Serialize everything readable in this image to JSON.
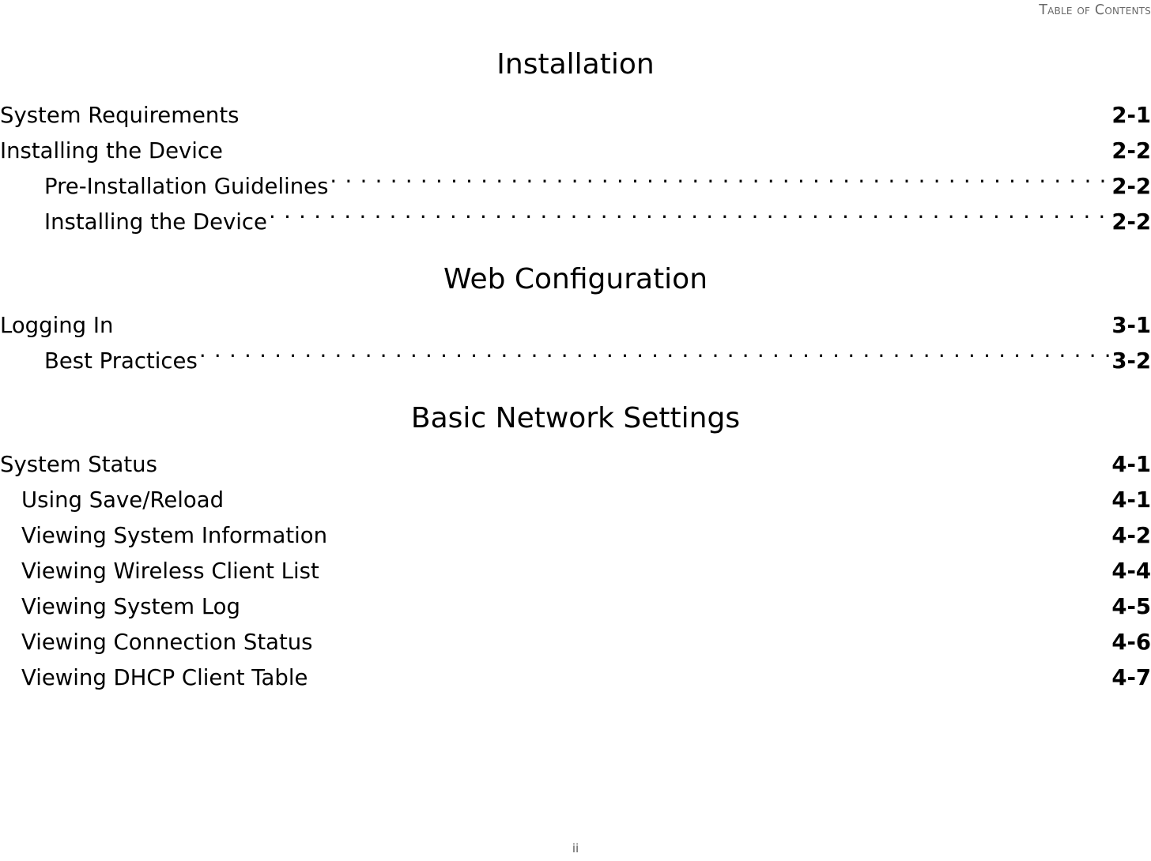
{
  "document": {
    "running_header": "Table of Contents",
    "footer_page_number": "ii"
  },
  "sections": [
    {
      "title": "Installation",
      "entries": [
        {
          "label": "System Requirements",
          "page": "2-1",
          "level": 1,
          "leader": false
        },
        {
          "label": "Installing the Device",
          "page": "2-2",
          "level": 1,
          "leader": false
        },
        {
          "label": "Pre-Installation Guidelines",
          "page": "2-2",
          "level": 2,
          "leader": true
        },
        {
          "label": "Installing the Device",
          "page": "2-2",
          "level": 2,
          "leader": true
        }
      ]
    },
    {
      "title": "Web Configuration",
      "entries": [
        {
          "label": "Logging In",
          "page": "3-1",
          "level": 1,
          "leader": false
        },
        {
          "label": "Best Practices",
          "page": "3-2",
          "level": 2,
          "leader": true
        }
      ]
    },
    {
      "title": "Basic Network Settings",
      "entries": [
        {
          "label": "System Status",
          "page": "4-1",
          "level": 1,
          "leader": false
        },
        {
          "label": "Using Save/Reload",
          "page": "4-1",
          "level": 2.1,
          "leader": false
        },
        {
          "label": "Viewing System Information",
          "page": "4-2",
          "level": 2.1,
          "leader": false
        },
        {
          "label": "Viewing Wireless Client List",
          "page": "4-4",
          "level": 2.1,
          "leader": false
        },
        {
          "label": "Viewing System Log",
          "page": "4-5",
          "level": 2.1,
          "leader": false
        },
        {
          "label": "Viewing Connection Status",
          "page": "4-6",
          "level": 2.1,
          "leader": false
        },
        {
          "label": "Viewing DHCP Client Table",
          "page": "4-7",
          "level": 2.1,
          "leader": false
        }
      ]
    }
  ],
  "colors": {
    "text": "#000000",
    "header_gray": "#696969",
    "footer_gray": "#595959",
    "background": "#ffffff"
  }
}
